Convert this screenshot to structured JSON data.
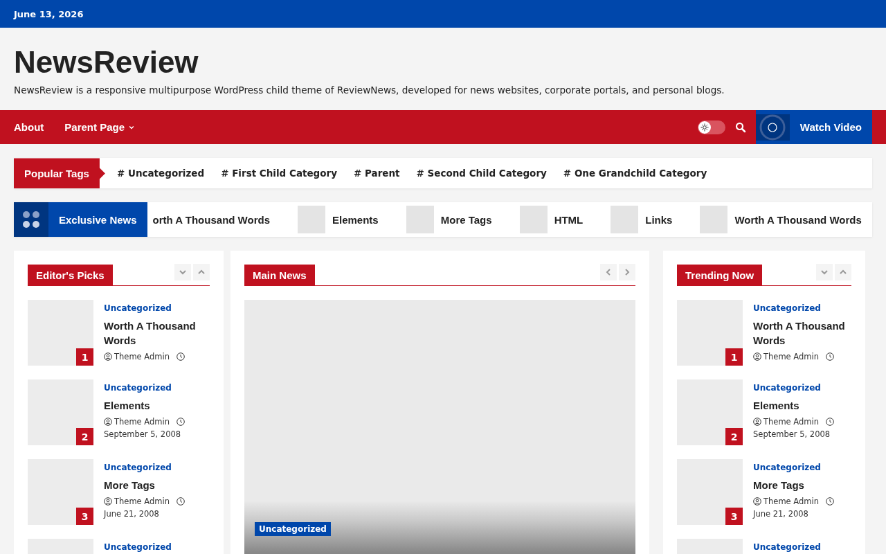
{
  "top_bar": {
    "date": "June 13, 2026"
  },
  "header": {
    "site_title": "NewsReview",
    "tagline": "NewsReview is a responsive multipurpose WordPress child theme of ReviewNews, developed for news websites, corporate portals, and personal blogs."
  },
  "nav": {
    "items": [
      {
        "label": "About",
        "has_submenu": false
      },
      {
        "label": "Parent Page",
        "has_submenu": true
      }
    ],
    "dark_mode": {
      "on": false
    },
    "watch_video": "Watch Video"
  },
  "popular_tags": {
    "label": "Popular Tags",
    "tags": [
      {
        "hash": "#",
        "label": "Uncategorized"
      },
      {
        "hash": "#",
        "label": "First Child Category"
      },
      {
        "hash": "#",
        "label": "Parent"
      },
      {
        "hash": "#",
        "label": "Second Child Category"
      },
      {
        "hash": "#",
        "label": "One Grandchild Category"
      }
    ]
  },
  "exclusive_news": {
    "label": "Exclusive News",
    "items": [
      {
        "title": "orth A Thousand Words",
        "thumb": false
      },
      {
        "title": "Elements",
        "thumb": true
      },
      {
        "title": "More Tags",
        "thumb": true
      },
      {
        "title": "HTML",
        "thumb": true
      },
      {
        "title": "Links",
        "thumb": true
      },
      {
        "title": "Worth A Thousand Words",
        "thumb": true
      }
    ]
  },
  "editors_picks": {
    "title": "Editor's Picks",
    "arrows": [
      {
        "kind": "down"
      },
      {
        "kind": "up"
      }
    ],
    "posts": [
      {
        "rank": "1",
        "category": "Uncategorized",
        "title": "Worth A Thousand Words",
        "author": "Theme Admin"
      },
      {
        "rank": "2",
        "category": "Uncategorized",
        "title": "Elements",
        "author": "Theme Admin",
        "date": "September 5, 2008"
      },
      {
        "rank": "3",
        "category": "Uncategorized",
        "title": "More Tags",
        "author": "Theme Admin",
        "date": "June 21, 2008"
      },
      {
        "category": "Uncategorized"
      }
    ]
  },
  "main_news": {
    "title": "Main News",
    "arrows": [
      {
        "kind": "previous"
      },
      {
        "kind": "next"
      }
    ],
    "category": "Uncategorized"
  },
  "trending_now": {
    "title": "Trending Now",
    "arrows": [
      {
        "kind": "down"
      },
      {
        "kind": "up"
      }
    ],
    "posts": [
      {
        "rank": "1",
        "category": "Uncategorized",
        "title": "Worth A Thousand Words",
        "author": "Theme Admin"
      },
      {
        "rank": "2",
        "category": "Uncategorized",
        "title": "Elements",
        "author": "Theme Admin",
        "date": "September 5, 2008"
      },
      {
        "rank": "3",
        "category": "Uncategorized",
        "title": "More Tags",
        "author": "Theme Admin",
        "date": "June 21, 2008"
      },
      {
        "category": "Uncategorized"
      }
    ]
  }
}
